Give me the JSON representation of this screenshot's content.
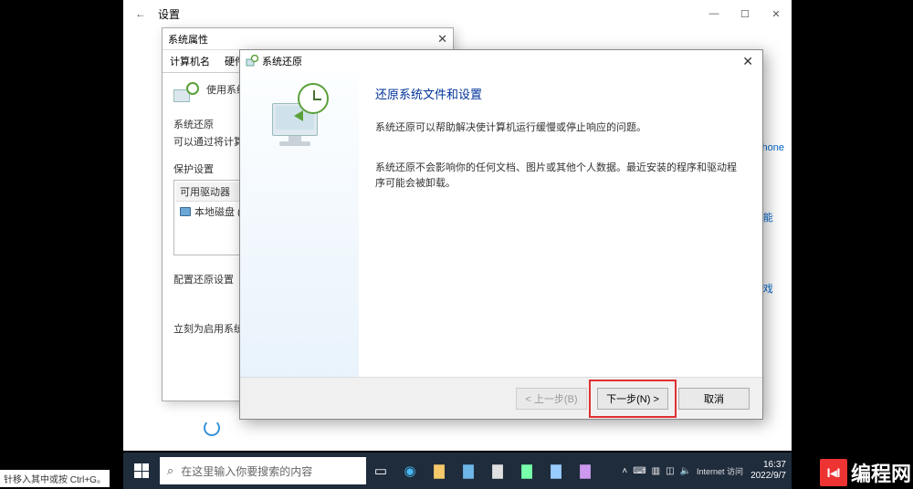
{
  "settings": {
    "title": "设置",
    "header": "设置",
    "back_glyph": "←",
    "minimize": "—",
    "maximize": "☐",
    "close": "✕"
  },
  "sysprops": {
    "title": "系统属性",
    "close": "✕",
    "tabs": {
      "computer_name": "计算机名",
      "hardware": "硬件"
    },
    "use_restore_label": "使用系统",
    "section_restore": "系统还原",
    "restore_desc": "可以通过将计算机\n系统更改。",
    "section_protect": "保护设置",
    "drives_header": "可用驱动器",
    "drive0": "本地磁盘 (C",
    "config_label": "配置还原设置",
    "create_label": "立刻为启用系统"
  },
  "restore": {
    "title": "系统还原",
    "close": "✕",
    "heading": "还原系统文件和设置",
    "para1": "系统还原可以帮助解决使计算机运行缓慢或停止响应的问题。",
    "para2": "系统还原不会影响你的任何文档、图片或其他个人数据。最近安装的程序和驱动程序可能会被卸载。",
    "back_btn": "< 上一步(B)",
    "next_btn": "下一步(N) >",
    "cancel_btn": "取消"
  },
  "rhints": {
    "iphone": "iPhone",
    "func": "功能",
    "game": "游戏"
  },
  "taskbar": {
    "search_placeholder": "在这里输入你要搜索的内容",
    "net_label": "Internet 访问",
    "time": "16:37",
    "date": "2022/9/7"
  },
  "watermark": {
    "text": "编程网"
  },
  "footer_hint": "针移入其中或按 Ctrl+G。"
}
